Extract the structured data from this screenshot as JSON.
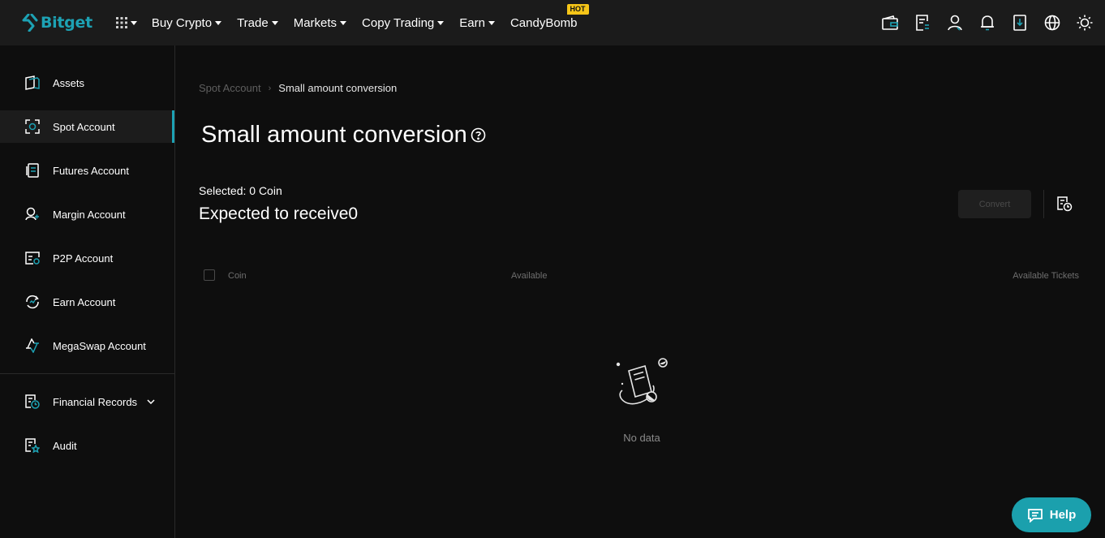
{
  "brand": {
    "name": "Bitget",
    "accent": "#1da2b4"
  },
  "nav": {
    "items": [
      {
        "label": "Buy Crypto",
        "caret": true
      },
      {
        "label": "Trade",
        "caret": true
      },
      {
        "label": "Markets",
        "caret": true
      },
      {
        "label": "Copy Trading",
        "caret": true
      },
      {
        "label": "Earn",
        "caret": true
      },
      {
        "label": "CandyBomb",
        "caret": false,
        "badge": "HOT"
      }
    ],
    "icons": [
      "wallet-icon",
      "orders-icon",
      "user-icon",
      "bell-icon",
      "download-icon",
      "globe-icon",
      "theme-sun-icon"
    ]
  },
  "sidebar": {
    "items": [
      {
        "label": "Assets",
        "icon": "assets-icon"
      },
      {
        "label": "Spot Account",
        "icon": "spot-account-icon",
        "active": true
      },
      {
        "label": "Futures Account",
        "icon": "futures-account-icon"
      },
      {
        "label": "Margin Account",
        "icon": "margin-account-icon"
      },
      {
        "label": "P2P Account",
        "icon": "p2p-account-icon"
      },
      {
        "label": "Earn Account",
        "icon": "earn-account-icon"
      },
      {
        "label": "MegaSwap Account",
        "icon": "megaswap-account-icon"
      },
      {
        "label": "Financial Records",
        "icon": "financial-records-icon",
        "expandable": true
      },
      {
        "label": "Audit",
        "icon": "audit-icon"
      }
    ]
  },
  "breadcrumb": {
    "parent": "Spot Account",
    "separator": "›",
    "current": "Small amount conversion"
  },
  "page": {
    "title": "Small amount conversion",
    "selected": "Selected: 0 Coin",
    "expected": "Expected to receive0",
    "convert_label": "Convert"
  },
  "table": {
    "columns": [
      "Coin",
      "Available",
      "Available Tickets"
    ],
    "rows": [],
    "empty_text": "No data"
  },
  "help": {
    "label": "Help",
    "color": "#1ba0ad"
  }
}
